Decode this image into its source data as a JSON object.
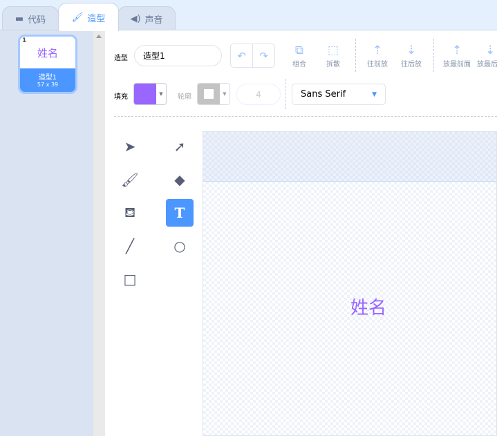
{
  "tabs": [
    {
      "label": "代码",
      "icon": "code-blocks-icon"
    },
    {
      "label": "造型",
      "icon": "brush-icon"
    },
    {
      "label": "声音",
      "icon": "speaker-icon"
    }
  ],
  "costumes": [
    {
      "number": "1",
      "preview_text": "姓名",
      "name": "造型1",
      "size": "57 x 39"
    }
  ],
  "toolbar": {
    "costume_label": "造型",
    "costume_name": "造型1",
    "group": "组合",
    "ungroup": "拆散",
    "forward": "往前放",
    "backward": "往后放",
    "front": "放最前面",
    "back": "放最后面"
  },
  "style": {
    "fill_label": "填充",
    "fill_color": "#9966ff",
    "outline_label": "轮廓",
    "outline_width": "4",
    "font": "Sans Serif"
  },
  "canvas": {
    "text": "姓名"
  }
}
